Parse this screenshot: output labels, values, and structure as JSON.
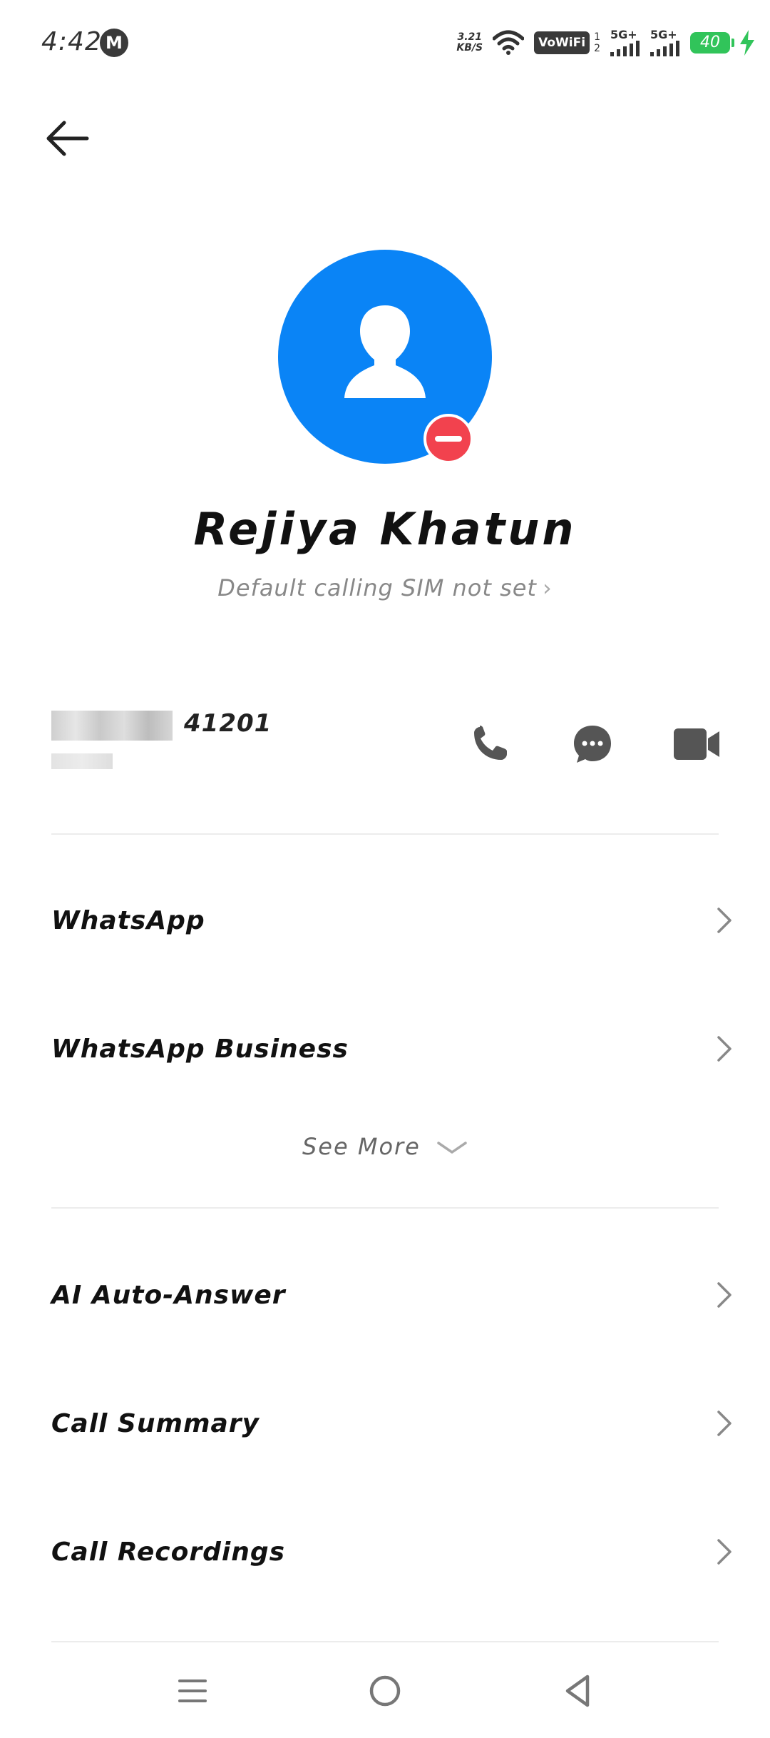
{
  "status_bar": {
    "time": "4:42",
    "carrier_icon": "M",
    "net_speed_value": "3.21",
    "net_speed_unit": "KB/S",
    "vowifi": "VoWiFi",
    "sim1": "1",
    "sim2": "2",
    "signal1_label": "5G+",
    "signal2_label": "5G+",
    "battery": "40"
  },
  "contact": {
    "name": "Rejiya Khatun",
    "sim_setting": "Default calling SIM not set"
  },
  "phone": {
    "number_suffix": "41201"
  },
  "apps": [
    {
      "label": "WhatsApp"
    },
    {
      "label": "WhatsApp Business"
    }
  ],
  "see_more": "See More",
  "features": [
    {
      "label": "AI Auto-Answer"
    },
    {
      "label": "Call Summary"
    },
    {
      "label": "Call Recordings"
    }
  ],
  "icons": {
    "back": "arrow-left",
    "call": "phone",
    "message": "chat-bubble",
    "video": "video-camera",
    "remove": "minus-circle"
  },
  "colors": {
    "avatar": "#0a84f6",
    "remove_badge": "#f2424e",
    "battery": "#31c45a"
  }
}
